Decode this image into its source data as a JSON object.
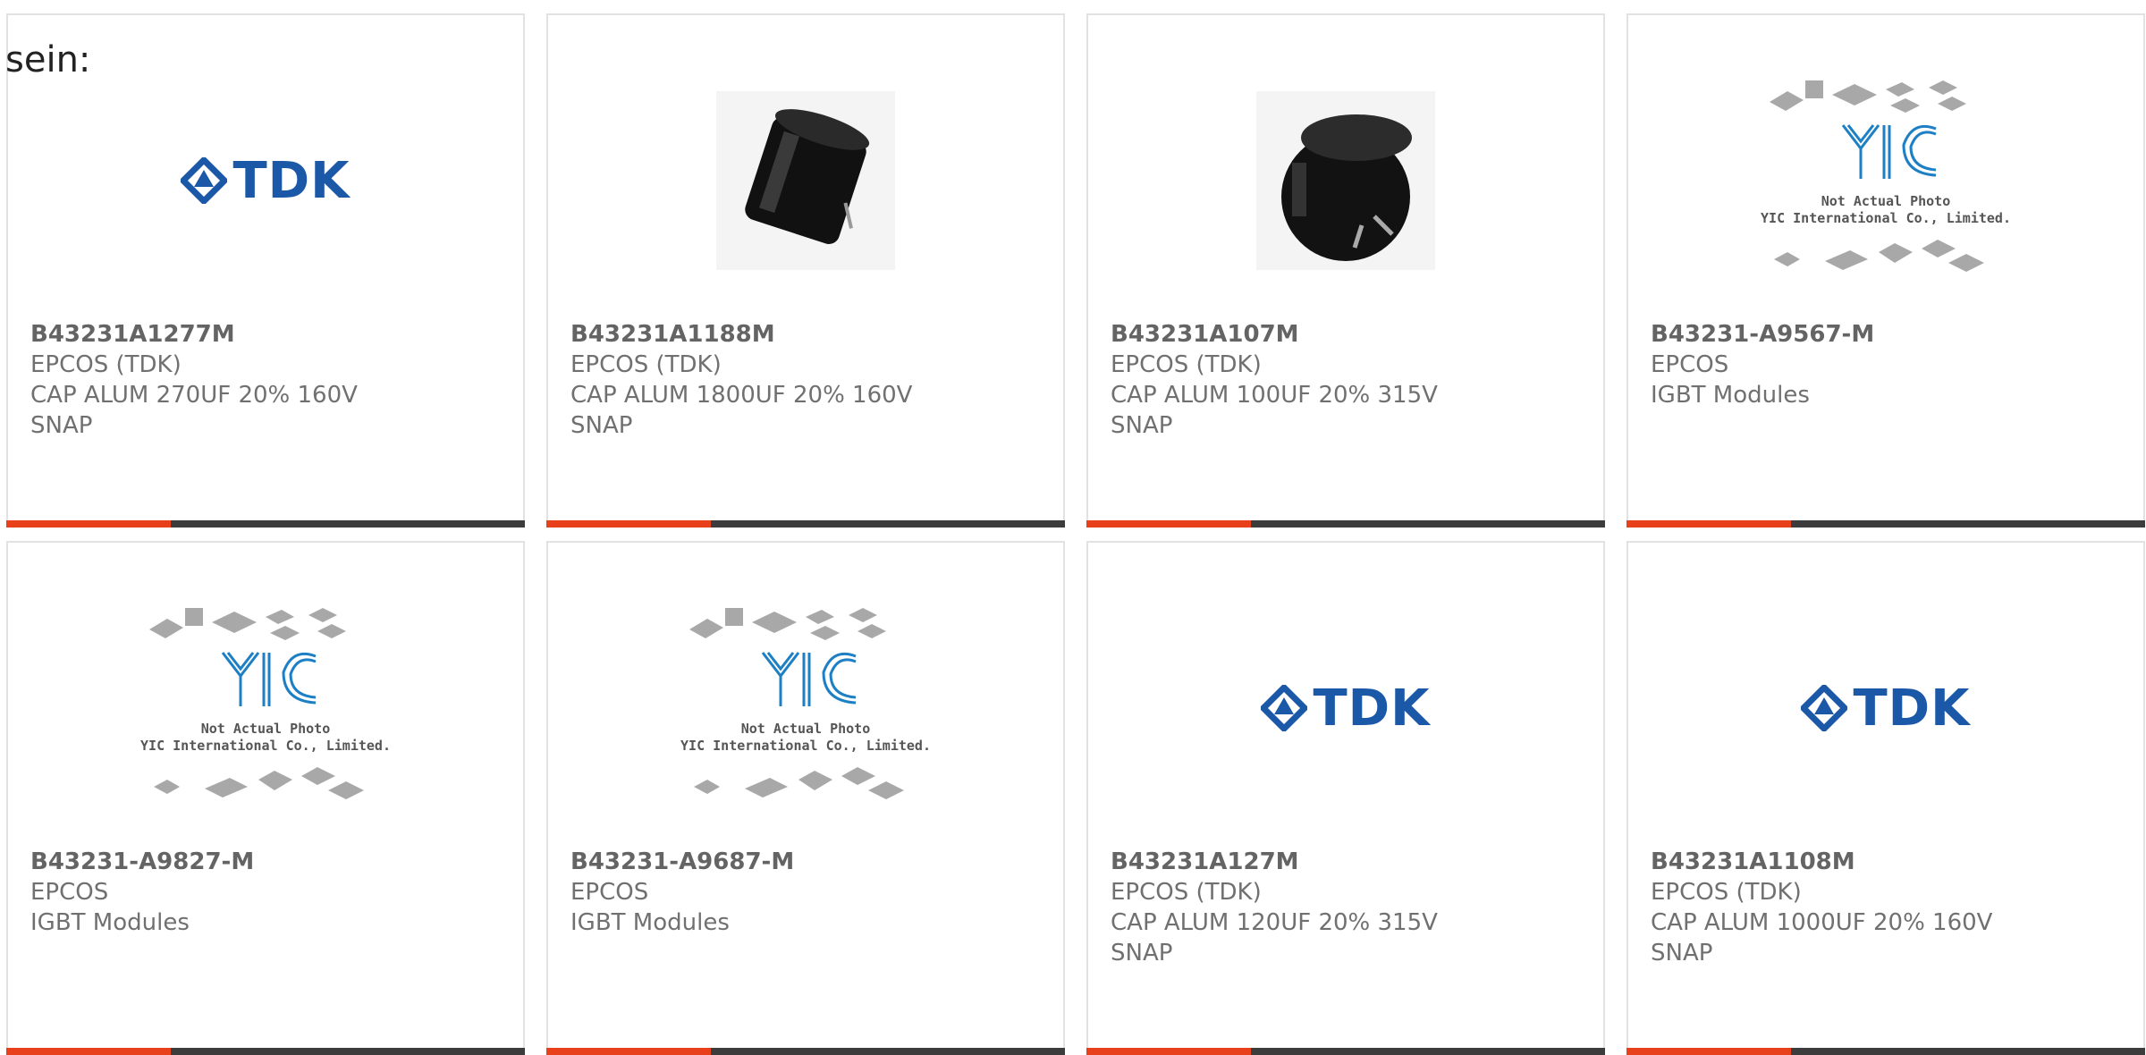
{
  "fragment_text": "sein:",
  "colors": {
    "accent_bar": "#e8401a",
    "bar_dark": "#3c3c3c",
    "tdk_blue": "#1b58a8",
    "yic_blue": "#1d7fc4"
  },
  "products": [
    {
      "image": "tdk-logo",
      "part_number": "B43231A1277M",
      "manufacturer": "EPCOS (TDK)",
      "desc1": "CAP ALUM 270UF 20% 160V",
      "desc2": "SNAP"
    },
    {
      "image": "capacitor-photo",
      "part_number": "B43231A1188M",
      "manufacturer": "EPCOS (TDK)",
      "desc1": "CAP ALUM 1800UF 20% 160V",
      "desc2": "SNAP"
    },
    {
      "image": "capacitor-photo",
      "part_number": "B43231A107M",
      "manufacturer": "EPCOS (TDK)",
      "desc1": "CAP ALUM 100UF 20% 315V",
      "desc2": "SNAP"
    },
    {
      "image": "yic-placeholder",
      "part_number": "B43231-A9567-M",
      "manufacturer": "EPCOS",
      "desc1": "IGBT Modules",
      "desc2": ""
    },
    {
      "image": "yic-placeholder",
      "part_number": "B43231-A9827-M",
      "manufacturer": "EPCOS",
      "desc1": "IGBT Modules",
      "desc2": ""
    },
    {
      "image": "yic-placeholder",
      "part_number": "B43231-A9687-M",
      "manufacturer": "EPCOS",
      "desc1": "IGBT Modules",
      "desc2": ""
    },
    {
      "image": "tdk-logo",
      "part_number": "B43231A127M",
      "manufacturer": "EPCOS (TDK)",
      "desc1": "CAP ALUM 120UF 20% 315V",
      "desc2": "SNAP"
    },
    {
      "image": "tdk-logo",
      "part_number": "B43231A1108M",
      "manufacturer": "EPCOS (TDK)",
      "desc1": "CAP ALUM 1000UF 20% 160V",
      "desc2": "SNAP"
    }
  ],
  "image_texts": {
    "tdk_logo": "TDK",
    "yic_line1": "Not Actual Photo",
    "yic_line2": "YIC International Co., Limited."
  }
}
